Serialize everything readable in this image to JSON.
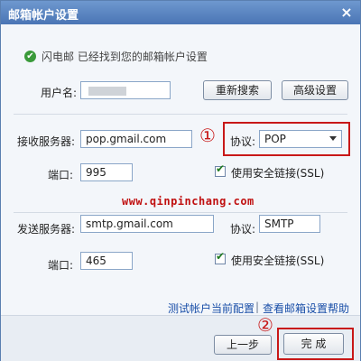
{
  "window": {
    "title": "邮箱帐户设置",
    "close_symbol": "×"
  },
  "status": {
    "text": "闪电邮 已经找到您的邮箱帐户设置"
  },
  "account": {
    "label": "用户名:",
    "search_button": "重新搜索",
    "advanced_button": "高级设置"
  },
  "incoming": {
    "label": "接收服务器:",
    "server": "pop.gmail.com",
    "protocol_label": "协议:",
    "protocol": "POP",
    "port_label": "端口:",
    "port": "995",
    "ssl_label": "使用安全链接(SSL)"
  },
  "outgoing": {
    "label": "发送服务器:",
    "server": "smtp.gmail.com",
    "protocol_label": "协议:",
    "protocol": "SMTP",
    "port_label": "端口:",
    "port": "465",
    "ssl_label": "使用安全链接(SSL)"
  },
  "links": {
    "test": "测试帐户当前配置",
    "separator": "|",
    "help": "查看邮箱设置帮助"
  },
  "watermark": "www.qinpinchang.com",
  "annotations": {
    "one": "①",
    "two": "②"
  },
  "footer": {
    "prev_button": "上一步",
    "finish_button": "完 成"
  },
  "colors": {
    "titlebar": "#4a75b5",
    "annotation_red": "#c81818",
    "link": "#1a4fa8"
  }
}
